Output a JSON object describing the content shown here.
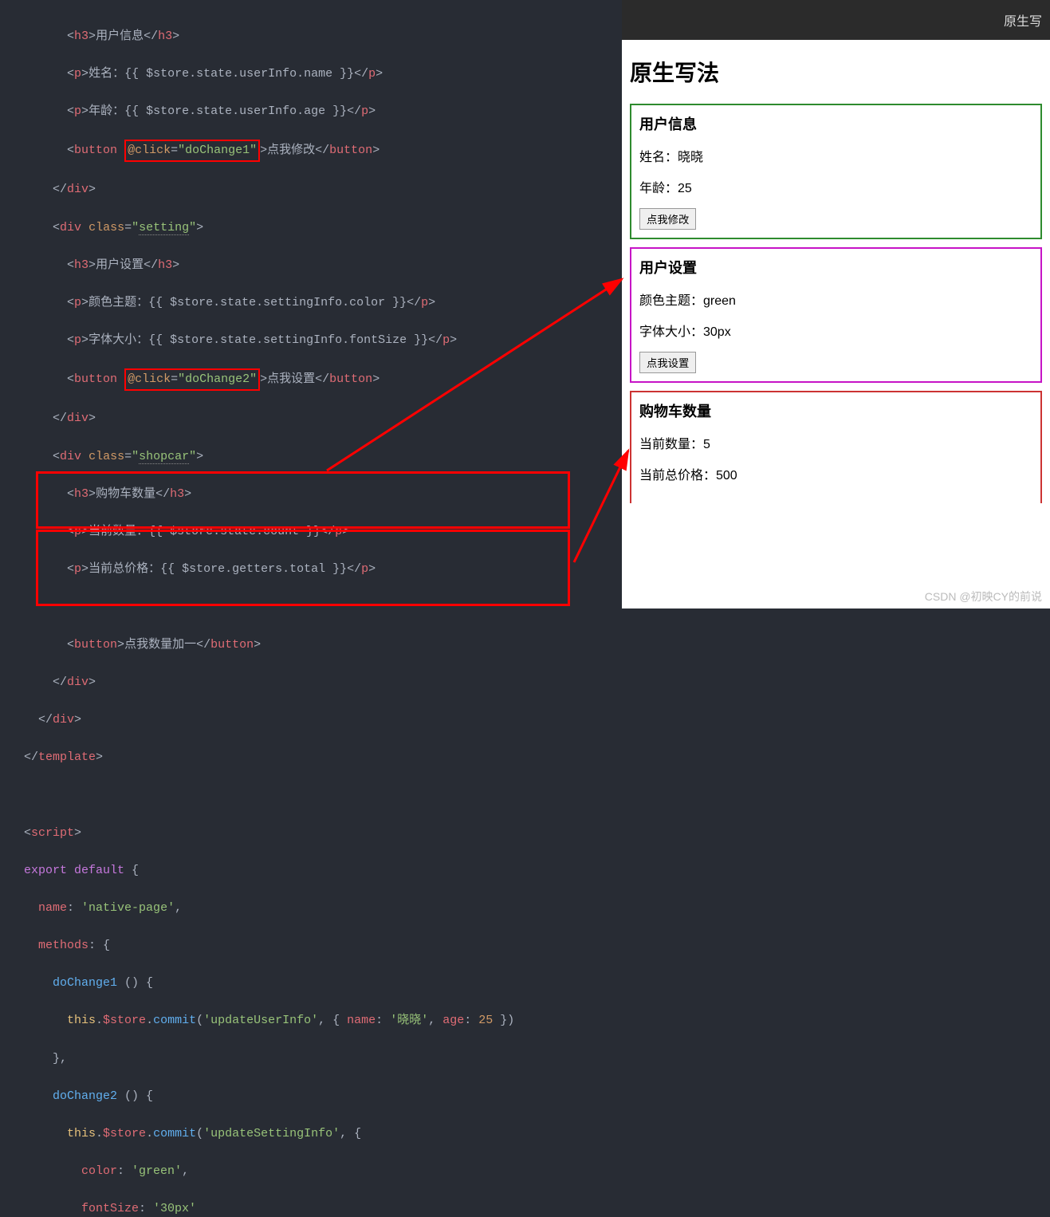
{
  "tabbar": {
    "title": "原生写"
  },
  "preview": {
    "heading": "原生写法",
    "user": {
      "title": "用户信息",
      "nameLabel": "姓名：晓晓",
      "ageLabel": "年龄：25",
      "btn": "点我修改"
    },
    "setting": {
      "title": "用户设置",
      "colorLabel": "颜色主题：green",
      "fontLabel": "字体大小：30px",
      "btn": "点我设置"
    },
    "shop": {
      "title": "购物车数量",
      "countLabel": "当前数量：5",
      "totalLabel": "当前总价格：500"
    }
  },
  "code": {
    "l1": {
      "open": "<",
      "tag": "h3",
      "close": ">",
      "text": "用户信息",
      "open2": "</",
      "close2": ">"
    },
    "l2": {
      "tag": "p",
      "text": "姓名：{{ $store.state.userInfo.name }}"
    },
    "l3": {
      "tag": "p",
      "text": "年龄：{{ $store.state.userInfo.age }}"
    },
    "l4": {
      "tag": "button",
      "attr": "@click",
      "val": "\"doChange1\"",
      "text": "点我修改"
    },
    "l5": {
      "tag": "div"
    },
    "l6": {
      "tag": "div",
      "attr": "class",
      "val": "\"",
      "valText": "setting",
      "val2": "\""
    },
    "l7": {
      "tag": "h3",
      "text": "用户设置"
    },
    "l8": {
      "tag": "p",
      "text": "颜色主题：{{ $store.state.settingInfo.color }}"
    },
    "l9": {
      "tag": "p",
      "text": "字体大小：{{ $store.state.settingInfo.fontSize }}"
    },
    "l10": {
      "tag": "button",
      "attr": "@click",
      "val": "\"doChange2\"",
      "text": "点我设置"
    },
    "l11": {
      "tag": "div"
    },
    "l12": {
      "tag": "div",
      "attr": "class",
      "valText": "shopcar"
    },
    "l13": {
      "tag": "h3",
      "text": "购物车数量"
    },
    "l14": {
      "tag": "p",
      "text": "当前数量：{{ $store.state.count }}"
    },
    "l15": {
      "tag": "p",
      "text": "当前总价格：{{ $store.getters.total }}"
    },
    "l16": {
      "tag": "button",
      "text": "点我数量加一"
    },
    "l17": {
      "tag": "div"
    },
    "l18": {
      "tag": "div"
    },
    "l19": {
      "tag": "template"
    },
    "l20": {
      "tag": "script"
    },
    "l21": {
      "kw1": "export",
      "kw2": "default",
      "brace": " {"
    },
    "l22": {
      "prop": "name",
      "val": "'native-page'"
    },
    "l23": {
      "prop": "methods"
    },
    "l24": {
      "func": "doChange1",
      "paren": " () {"
    },
    "l25": {
      "this": "this",
      "dot1": ".",
      "store": "$store",
      "dot2": ".",
      "commit": "commit",
      "p1": "(",
      "s1": "'updateUserInfo'",
      "c1": ", { ",
      "k1": "name",
      "c2": ": ",
      "v1": "'晓晓'",
      "c3": ", ",
      "k2": "age",
      "c4": ": ",
      "v2": "25",
      "c5": " })"
    },
    "l26": {
      "txt": "},"
    },
    "l27": {
      "func": "doChange2",
      "paren": " () {"
    },
    "l28": {
      "this": "this",
      "store": "$store",
      "commit": "commit",
      "s1": "'updateSettingInfo'",
      "tail": ", {"
    },
    "l29": {
      "k": "color",
      "v": "'green'"
    },
    "l30": {
      "k": "fontSize",
      "v": "'30px'"
    }
  },
  "watermark": "CSDN @初映CY的前说"
}
